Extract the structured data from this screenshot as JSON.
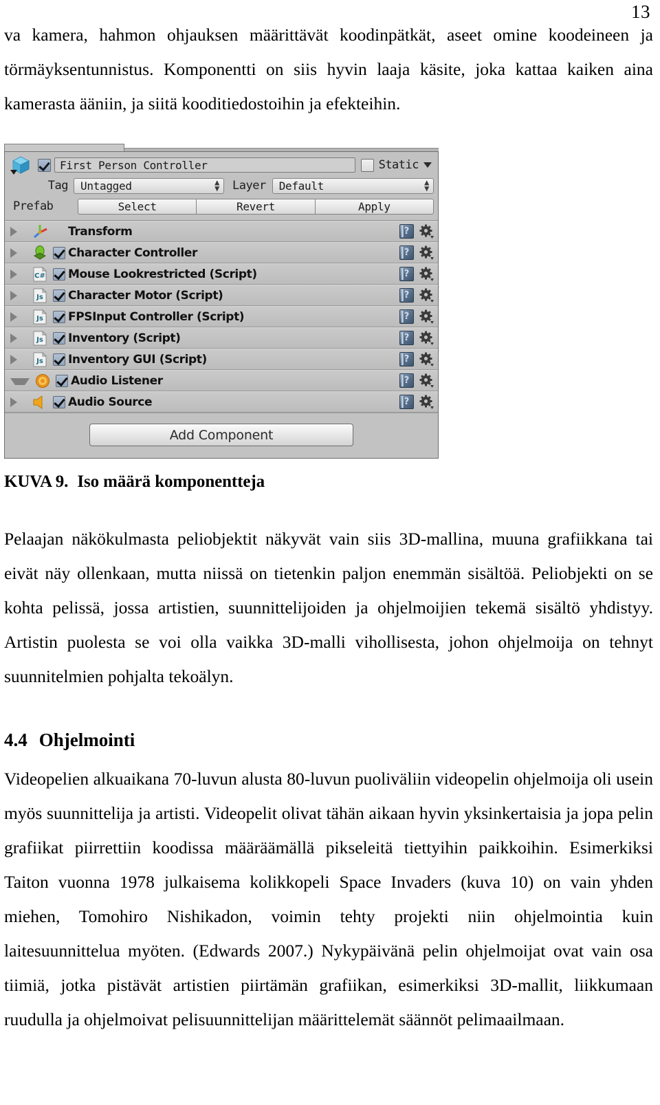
{
  "page": {
    "number": "13"
  },
  "intro_paragraph": "va kamera, hahmon ohjauksen määrittävät koodinpätkät, aseet omine koodeineen ja törmäyksentunnistus. Komponentti on siis hyvin laaja käsite, joka kattaa kaiken aina kamerasta ääniin, ja siitä kooditiedostoihin ja efekteihin.",
  "figure": {
    "caption_label": "KUVA 9.",
    "caption_text": "Iso määrä komponentteja",
    "inspector": {
      "object_icon": "prefab-cube-icon",
      "enabled_checkbox": true,
      "object_name": "First Person Controller",
      "static_label": "Static",
      "static_checked": false,
      "tag_label": "Tag",
      "tag_value": "Untagged",
      "layer_label": "Layer",
      "layer_value": "Default",
      "prefab_label": "Prefab",
      "prefab_buttons": [
        "Select",
        "Revert",
        "Apply"
      ],
      "help_glyph": "?",
      "components": [
        {
          "name": "Transform",
          "icon": "transform-gizmo-icon",
          "has_checkbox": false,
          "checked": false,
          "expanded": false
        },
        {
          "name": "Character Controller",
          "icon": "character-controller-icon",
          "has_checkbox": true,
          "checked": true,
          "expanded": false
        },
        {
          "name": "Mouse Lookrestricted (Script)",
          "icon": "csharp-script-icon",
          "has_checkbox": true,
          "checked": true,
          "expanded": false
        },
        {
          "name": "Character Motor (Script)",
          "icon": "js-script-icon",
          "has_checkbox": true,
          "checked": true,
          "expanded": false
        },
        {
          "name": "FPSInput Controller (Script)",
          "icon": "js-script-icon",
          "has_checkbox": true,
          "checked": true,
          "expanded": false
        },
        {
          "name": "Inventory (Script)",
          "icon": "js-script-icon",
          "has_checkbox": true,
          "checked": true,
          "expanded": false
        },
        {
          "name": "Inventory GUI (Script)",
          "icon": "js-script-icon",
          "has_checkbox": true,
          "checked": true,
          "expanded": false
        },
        {
          "name": "Audio Listener",
          "icon": "audio-listener-icon",
          "has_checkbox": true,
          "checked": true,
          "expanded": true
        },
        {
          "name": "Audio Source",
          "icon": "audio-source-icon",
          "has_checkbox": true,
          "checked": true,
          "expanded": false
        }
      ],
      "add_component_label": "Add Component"
    }
  },
  "paragraph_2": "Pelaajan näkökulmasta peliobjektit näkyvät vain siis 3D-mallina, muuna grafiikkana tai eivät näy ollenkaan, mutta niissä on tietenkin paljon enemmän sisältöä. Peliobjekti on se kohta pelissä, jossa artistien, suunnittelijoiden ja ohjelmoijien tekemä sisältö yhdistyy. Artistin puolesta se voi olla vaikka 3D-malli vihollisesta, johon ohjelmoija on tehnyt suunnitelmien pohjalta tekoälyn.",
  "section": {
    "number": "4.4",
    "title": "Ohjelmointi"
  },
  "paragraph_3": "Videopelien alkuaikana 70-luvun alusta 80-luvun puoliväliin videopelin ohjelmoija oli usein myös suunnittelija ja artisti. Videopelit olivat tähän aikaan hyvin yksinkertaisia ja jopa pelin grafiikat piirrettiin koodissa määräämällä pikseleitä tiettyihin paikkoihin. Esimerkiksi Taiton vuonna 1978 julkaisema kolikkopeli Space Invaders (kuva 10) on vain yhden miehen, Tomohiro Nishikadon, voimin tehty projekti niin ohjelmointia kuin laitesuunnittelua myöten. (Edwards 2007.) Nykypäivänä pelin ohjelmoijat ovat vain osa tiimiä, jotka pistävät artistien piirtämän grafiikan, esimerkiksi 3D-mallit, liikkumaan ruudulla ja ohjelmoivat pelisuunnittelijan määrittelemät säännöt pelimaailmaan.",
  "colors": {
    "panel_bg": "#c2c2c2",
    "row_bg": "#c6c6c6",
    "checkbox_blue": "#93a6bd",
    "prefab_cube": "#5bb8e0",
    "audio_orange": "#f0a029",
    "capsule_green": "#6fb62a"
  }
}
